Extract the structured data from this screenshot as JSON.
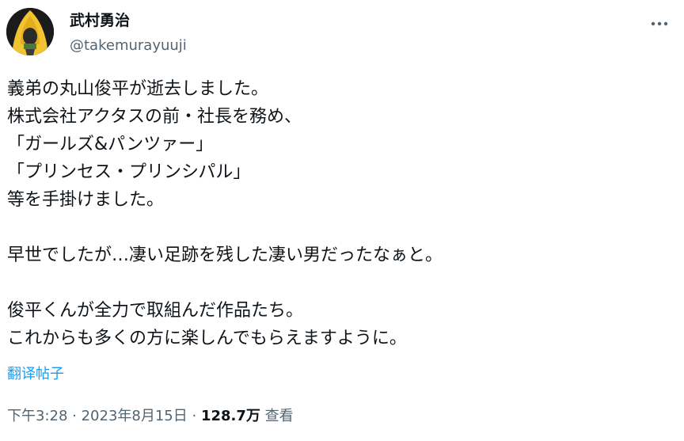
{
  "author": {
    "display_name": "武村勇治",
    "handle": "@takemurayuuji",
    "avatar_icon": "hooded-figure-avatar-icon"
  },
  "more_icon": "more-horizontal-icon",
  "tweet": {
    "lines": [
      "義弟の丸山俊平が逝去しました。",
      "株式会社アクタスの前・社長を務め、",
      "「ガールズ&パンツァー」",
      "「プリンセス・プリンシパル」",
      "等を手掛けました。",
      "",
      "早世でしたが…凄い足跡を残した凄い男だったなぁと。",
      "",
      "俊平くんが全力で取組んだ作品たち。",
      "これからも多くの方に楽しんでもらえますように。"
    ]
  },
  "translate_label": "翻译帖子",
  "meta": {
    "time": "下午3:28",
    "separator": " · ",
    "date": "2023年8月15日",
    "views_count": "128.7万",
    "views_label": " 查看"
  },
  "colors": {
    "text_primary": "#0f1419",
    "text_secondary": "#536471",
    "link": "#1d9bf0",
    "avatar_hood": "#f4c430"
  }
}
